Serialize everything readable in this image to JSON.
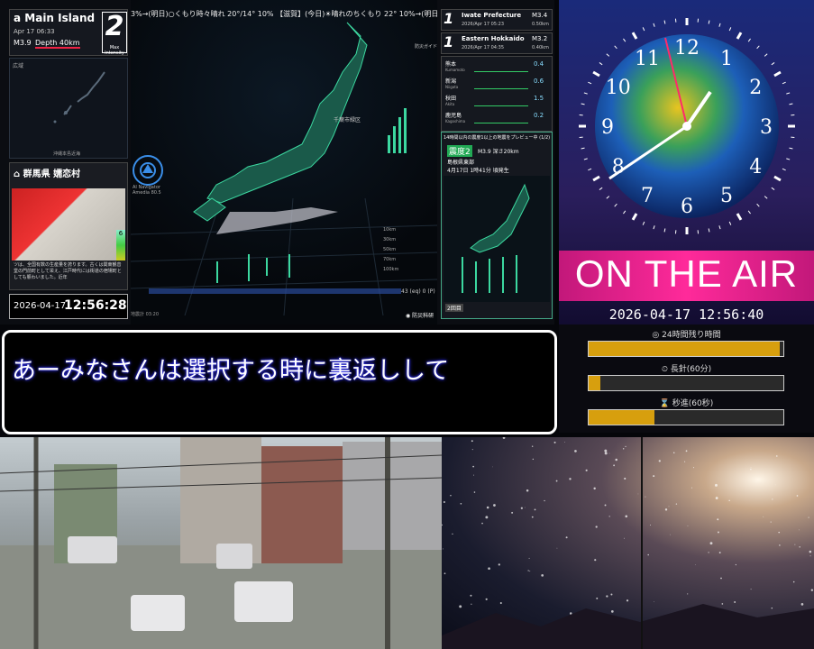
{
  "ticker": "3%→(明日)○くもり時々晴れ 20°/14° 10% 【滋賀】(今日)☀晴れのちくもり 22° 10%→(明日)○くもり時",
  "quake": {
    "title": "a Main Island",
    "date": "Apr 17 06:33",
    "magnitude": "M3.9",
    "depth": "Depth 40km",
    "intensity": "2",
    "intensity_label": "Max Intensity"
  },
  "mini_map": {
    "label": "広域",
    "sub": "沖縄本島近海"
  },
  "info_card": {
    "title": "⌂ 群馬県 嬬恋村",
    "level": "6",
    "text": "ツは、全国有数の生産量を誇ります。古くは関東観音堂の門前町として栄え、江戸時代には街道の宿場町としても賑わいました。近年"
  },
  "clock": {
    "date": "2026-04-17",
    "time": "12:56:28"
  },
  "map_view": {
    "ai_label": "AI Navigator\nAmedia 80.5",
    "map_label": "千葉市緑区",
    "bosai_guide": "防災ガイド",
    "bosai_badge": "◉ 防災科研",
    "time_stamp": "地震計 03:20",
    "depth_legend": [
      "10km",
      "30km",
      "50km",
      "70km",
      "100km"
    ],
    "stats": "43 (eq)  0 (P)"
  },
  "quake_list": [
    {
      "num": "1",
      "name": "Iwate Prefecture",
      "date": "2026/Apr 17 05:23",
      "mag": "M3.4",
      "depth": "0.50km"
    },
    {
      "num": "1",
      "name": "Eastern Hokkaido",
      "date": "2026/Apr 17 04:35",
      "mag": "M3.2",
      "depth": "0.40km"
    }
  ],
  "sensors": [
    {
      "name": "熊本",
      "sub": "Kumamoto",
      "val": "0.4"
    },
    {
      "name": "新潟",
      "sub": "Niigata",
      "val": "0.6"
    },
    {
      "name": "秋田",
      "sub": "Akita",
      "val": "1.5"
    },
    {
      "name": "鹿児島",
      "sub": "Kagoshima",
      "val": "0.2"
    }
  ],
  "preview": {
    "title": "14時間以内の震度1以上の地震をプレビュー中 (1/2)",
    "intensity": "震度2",
    "depth": "M3.9 深さ20km",
    "region": "島根県東部",
    "time": "4月17日 1時41分 頃発生",
    "tag": "2回目"
  },
  "on_air": "ON THE AIR",
  "live_datetime": "2026-04-17 12:56:40",
  "progress": [
    {
      "label": "◎ 24時間残り時間",
      "fraction": 0.98
    },
    {
      "label": "⏲ 長針(60分)",
      "fraction": 0.06
    },
    {
      "label": "⌛ 秒進(60秒)",
      "fraction": 0.34
    }
  ],
  "subtitle": "あーみなさんは選択する時に裏返しして",
  "clock_numerals": [
    "12",
    "1",
    "2",
    "3",
    "4",
    "5",
    "6",
    "7",
    "8",
    "9",
    "10",
    "11"
  ]
}
